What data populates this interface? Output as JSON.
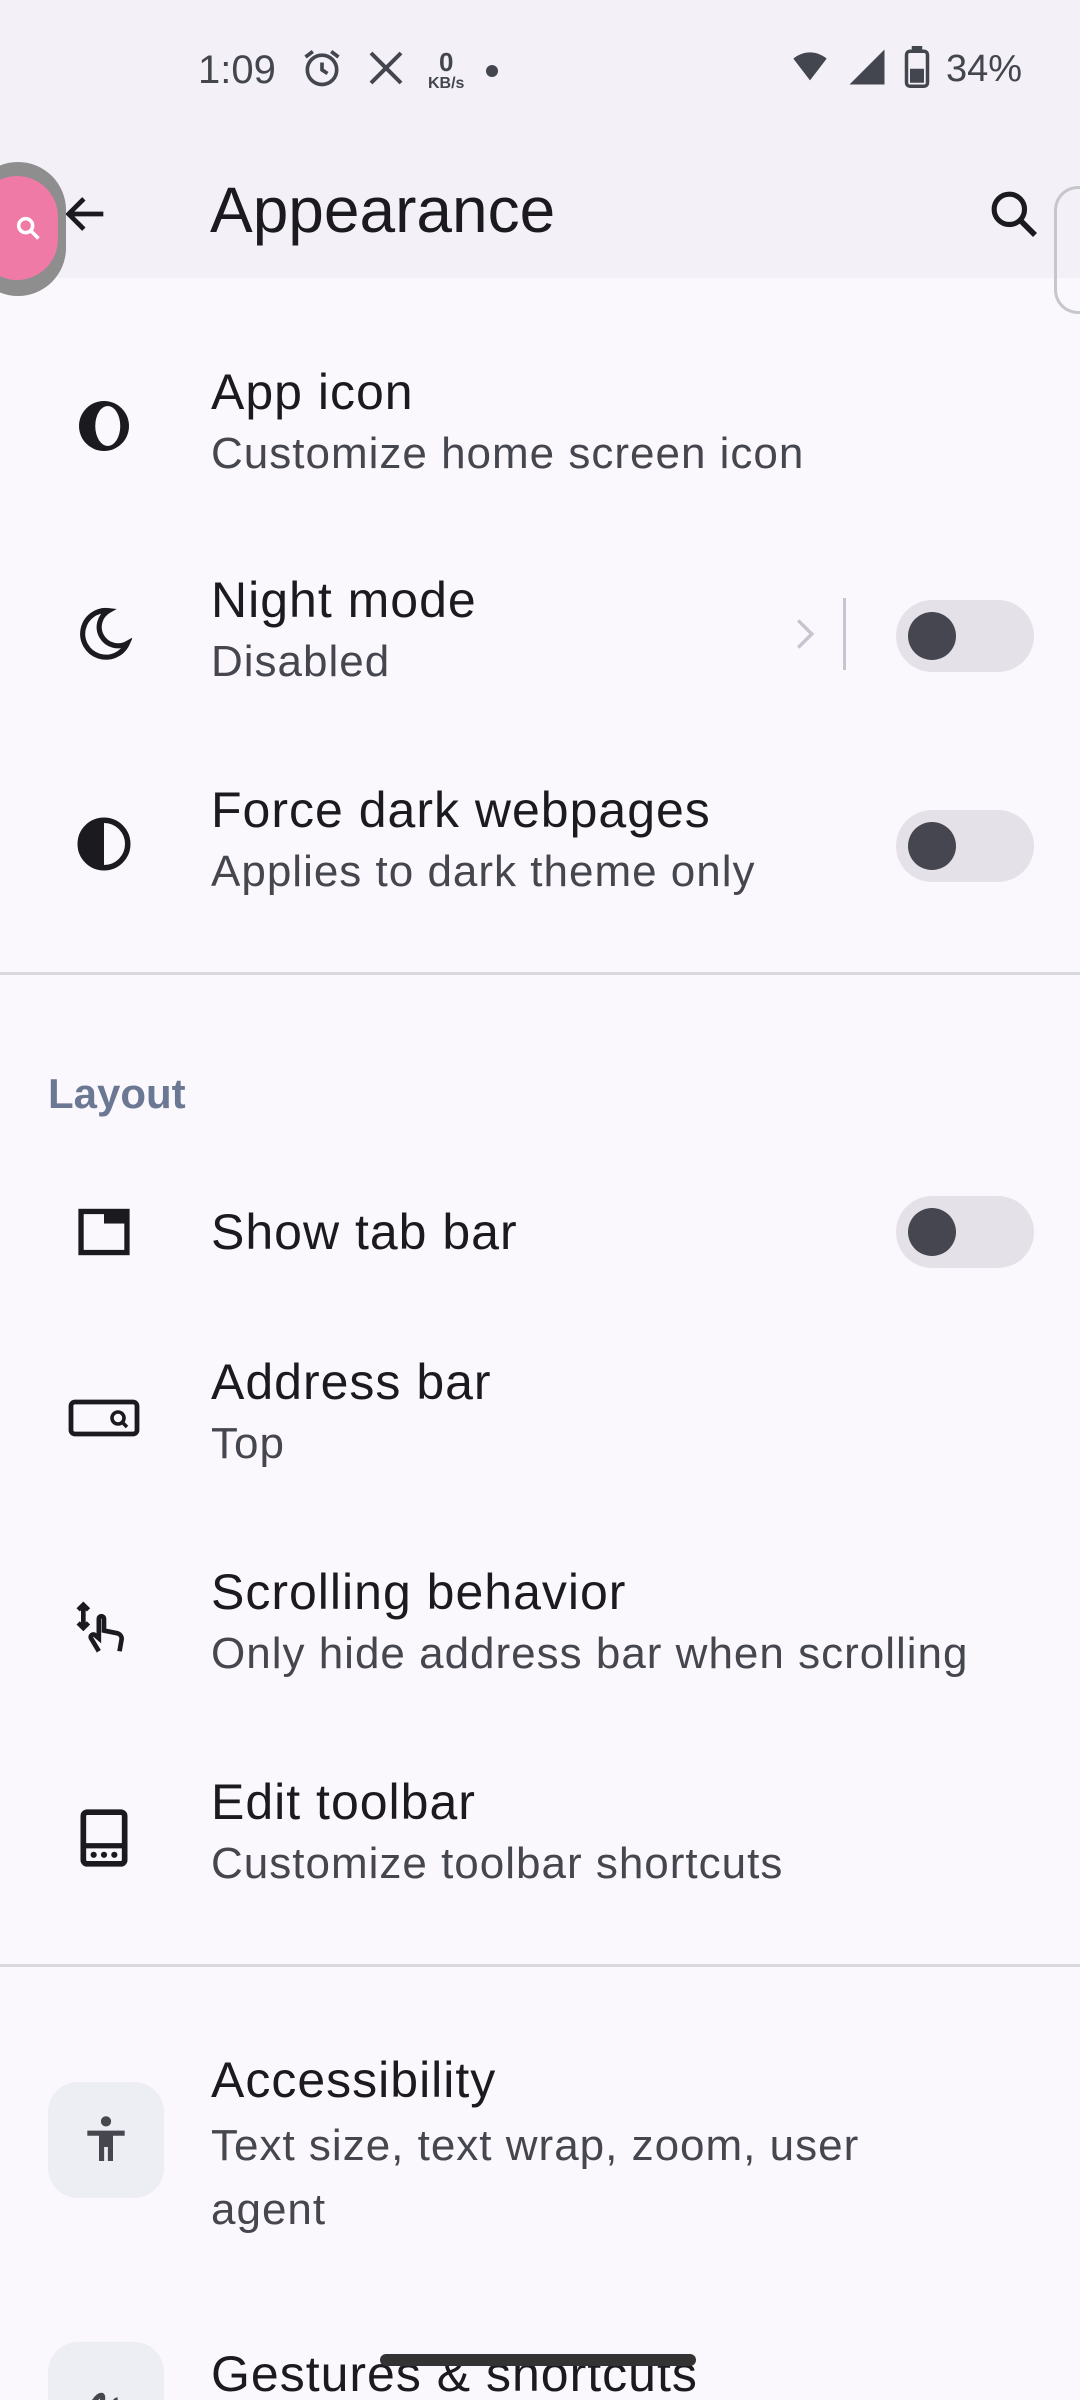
{
  "status_bar": {
    "time": "1:09",
    "network_speed_value": "0",
    "network_speed_unit": "KB/s",
    "battery": "34%"
  },
  "app_bar": {
    "title": "Appearance"
  },
  "items": {
    "app_icon": {
      "title": "App icon",
      "subtitle": "Customize home screen icon"
    },
    "night_mode": {
      "title": "Night mode",
      "subtitle": "Disabled",
      "enabled": false
    },
    "force_dark": {
      "title": "Force dark webpages",
      "subtitle": "Applies to dark theme only",
      "enabled": false
    },
    "show_tab_bar": {
      "title": "Show tab bar",
      "enabled": false
    },
    "address_bar": {
      "title": "Address bar",
      "subtitle": "Top"
    },
    "scrolling": {
      "title": "Scrolling behavior",
      "subtitle": "Only hide address bar when scrolling"
    },
    "edit_toolbar": {
      "title": "Edit toolbar",
      "subtitle": "Customize toolbar shortcuts"
    },
    "accessibility": {
      "title": "Accessibility",
      "subtitle_line1": "Text size, text wrap, zoom, user",
      "subtitle_line2": "agent"
    },
    "gestures": {
      "title": "Gestures & shortcuts"
    }
  },
  "sections": {
    "layout": "Layout"
  },
  "colors": {
    "background": "#fbf8fd",
    "app_bar": "#f3f1f7",
    "section_label": "#6b7894",
    "switch_track": "#e4e1e8",
    "switch_knob": "#45464f",
    "bubble": "#ef7aa6"
  }
}
